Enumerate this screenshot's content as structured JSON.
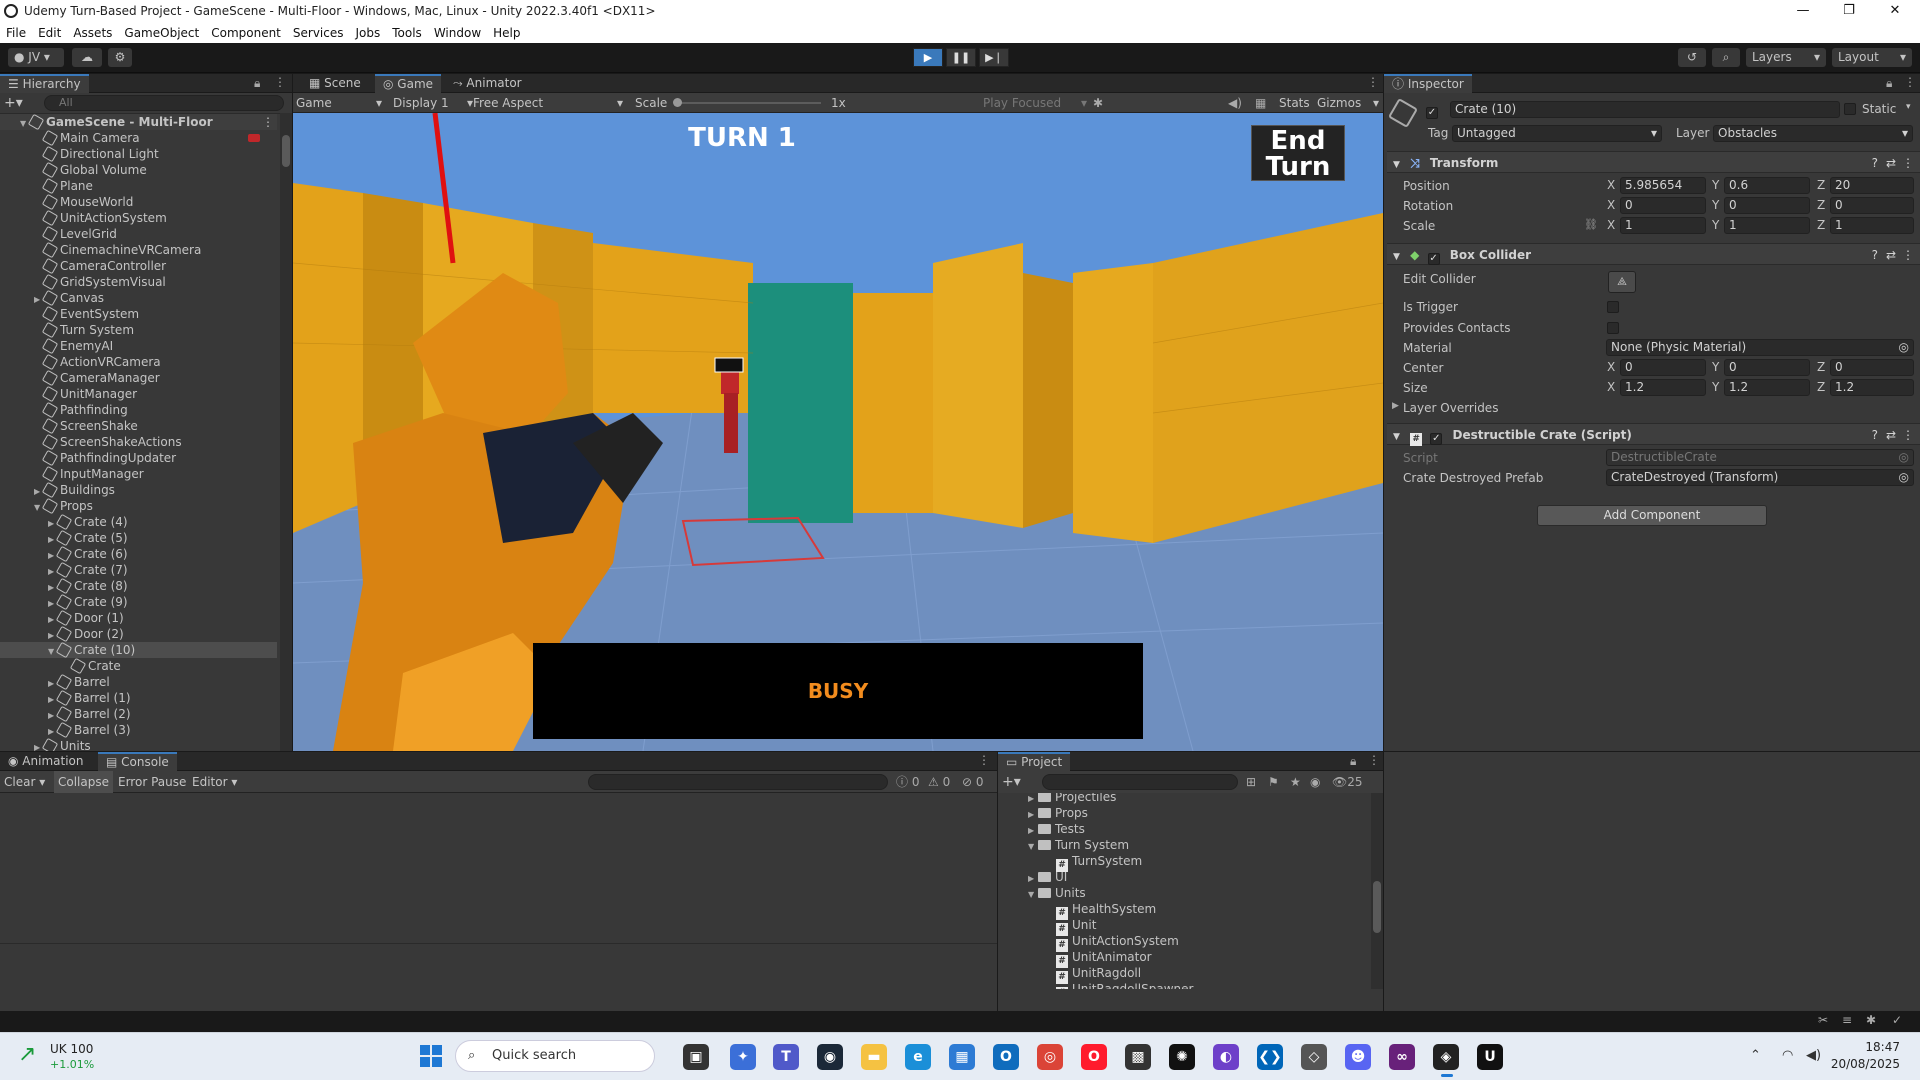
{
  "window": {
    "title": "Udemy Turn-Based Project - GameScene - Multi-Floor - Windows, Mac, Linux - Unity 2022.3.40f1 <DX11>",
    "minimize": "—",
    "maximize": "❐",
    "close": "✕"
  },
  "menu": [
    "File",
    "Edit",
    "Assets",
    "GameObject",
    "Component",
    "Services",
    "Jobs",
    "Tools",
    "Window",
    "Help"
  ],
  "toolbar": {
    "account": "JV",
    "layers": "Layers",
    "layout": "Layout"
  },
  "hierarchy": {
    "tab": "Hierarchy",
    "search_placeholder": "All",
    "items": [
      {
        "label": "GameScene - Multi-Floor",
        "depth": 0,
        "expanded": true,
        "scene": true
      },
      {
        "label": "Main Camera",
        "depth": 1
      },
      {
        "label": "Directional Light",
        "depth": 1
      },
      {
        "label": "Global Volume",
        "depth": 1
      },
      {
        "label": "Plane",
        "depth": 1
      },
      {
        "label": "MouseWorld",
        "depth": 1
      },
      {
        "label": "UnitActionSystem",
        "depth": 1
      },
      {
        "label": "LevelGrid",
        "depth": 1
      },
      {
        "label": "CinemachineVRCamera",
        "depth": 1
      },
      {
        "label": "CameraController",
        "depth": 1
      },
      {
        "label": "GridSystemVisual",
        "depth": 1
      },
      {
        "label": "Canvas",
        "depth": 1,
        "collapsed": true
      },
      {
        "label": "EventSystem",
        "depth": 1
      },
      {
        "label": "Turn System",
        "depth": 1
      },
      {
        "label": "EnemyAI",
        "depth": 1
      },
      {
        "label": "ActionVRCamera",
        "depth": 1
      },
      {
        "label": "CameraManager",
        "depth": 1
      },
      {
        "label": "UnitManager",
        "depth": 1
      },
      {
        "label": "Pathfinding",
        "depth": 1
      },
      {
        "label": "ScreenShake",
        "depth": 1
      },
      {
        "label": "ScreenShakeActions",
        "depth": 1
      },
      {
        "label": "PathfindingUpdater",
        "depth": 1
      },
      {
        "label": "InputManager",
        "depth": 1
      },
      {
        "label": "Buildings",
        "depth": 1,
        "collapsed": true
      },
      {
        "label": "Props",
        "depth": 1,
        "expanded": true
      },
      {
        "label": "Crate (4)",
        "depth": 2,
        "collapsed": true
      },
      {
        "label": "Crate (5)",
        "depth": 2,
        "collapsed": true
      },
      {
        "label": "Crate (6)",
        "depth": 2,
        "collapsed": true
      },
      {
        "label": "Crate (7)",
        "depth": 2,
        "collapsed": true
      },
      {
        "label": "Crate (8)",
        "depth": 2,
        "collapsed": true
      },
      {
        "label": "Crate (9)",
        "depth": 2,
        "collapsed": true
      },
      {
        "label": "Door (1)",
        "depth": 2,
        "collapsed": true
      },
      {
        "label": "Door (2)",
        "depth": 2,
        "collapsed": true
      },
      {
        "label": "Crate (10)",
        "depth": 2,
        "expanded": true,
        "selected": true
      },
      {
        "label": "Crate",
        "depth": 3
      },
      {
        "label": "Barrel",
        "depth": 2,
        "collapsed": true
      },
      {
        "label": "Barrel (1)",
        "depth": 2,
        "collapsed": true
      },
      {
        "label": "Barrel (2)",
        "depth": 2,
        "collapsed": true
      },
      {
        "label": "Barrel (3)",
        "depth": 2,
        "collapsed": true
      },
      {
        "label": "Units",
        "depth": 1,
        "collapsed": true
      }
    ]
  },
  "view_tabs": [
    "Scene",
    "Game",
    "Animator"
  ],
  "game_bar": {
    "game": "Game",
    "display": "Display 1",
    "aspect": "Free Aspect",
    "scale_label": "Scale",
    "scale_value": "1x",
    "play_focused": "Play Focused",
    "stats": "Stats",
    "gizmos": "Gizmos"
  },
  "game": {
    "turn": "TURN 1",
    "end_turn_line1": "End",
    "end_turn_line2": "Turn",
    "busy": "BUSY"
  },
  "inspector": {
    "tab": "Inspector",
    "object_name": "Crate (10)",
    "static": "Static",
    "tag_label": "Tag",
    "tag": "Untagged",
    "layer_label": "Layer",
    "layer": "Obstacles",
    "transform": {
      "title": "Transform",
      "position": {
        "label": "Position",
        "x": "5.985654",
        "y": "0.6",
        "z": "20"
      },
      "rotation": {
        "label": "Rotation",
        "x": "0",
        "y": "0",
        "z": "0"
      },
      "scale": {
        "label": "Scale",
        "x": "1",
        "y": "1",
        "z": "1"
      }
    },
    "box_collider": {
      "title": "Box Collider",
      "edit_collider": "Edit Collider",
      "is_trigger": "Is Trigger",
      "provides_contacts": "Provides Contacts",
      "material_label": "Material",
      "material": "None (Physic Material)",
      "center": {
        "label": "Center",
        "x": "0",
        "y": "0",
        "z": "0"
      },
      "size": {
        "label": "Size",
        "x": "1.2",
        "y": "1.2",
        "z": "1.2"
      },
      "layer_overrides": "Layer Overrides"
    },
    "script": {
      "title": "Destructible Crate (Script)",
      "script_label": "Script",
      "script_value": "DestructibleCrate",
      "prefab_label": "Crate Destroyed Prefab",
      "prefab_value": "CrateDestroyed (Transform)"
    },
    "add_component": "Add Component"
  },
  "console": {
    "tabs": [
      "Animation",
      "Console"
    ],
    "clear": "Clear",
    "collapse": "Collapse",
    "error_pause": "Error Pause",
    "editor": "Editor",
    "count_log": "0",
    "count_warn": "0",
    "count_err": "0"
  },
  "project": {
    "tab": "Project",
    "count": "25",
    "items": [
      {
        "label": "Projectiles",
        "type": "folder",
        "depth": 1
      },
      {
        "label": "Props",
        "type": "folder",
        "depth": 1
      },
      {
        "label": "Tests",
        "type": "folder",
        "depth": 1
      },
      {
        "label": "Turn System",
        "type": "folder",
        "depth": 1,
        "expanded": true
      },
      {
        "label": "TurnSystem",
        "type": "script",
        "depth": 2
      },
      {
        "label": "UI",
        "type": "folder",
        "depth": 1
      },
      {
        "label": "Units",
        "type": "folder",
        "depth": 1,
        "expanded": true
      },
      {
        "label": "HealthSystem",
        "type": "script",
        "depth": 2
      },
      {
        "label": "Unit",
        "type": "script",
        "depth": 2
      },
      {
        "label": "UnitActionSystem",
        "type": "script",
        "depth": 2
      },
      {
        "label": "UnitAnimator",
        "type": "script",
        "depth": 2
      },
      {
        "label": "UnitRagdoll",
        "type": "script",
        "depth": 2
      },
      {
        "label": "UnitRagdollSpawner",
        "type": "script",
        "depth": 2
      }
    ]
  },
  "taskbar": {
    "stock_name": "UK 100",
    "stock_change": "+1.01%",
    "search": "Quick search",
    "time": "18:47",
    "date": "20/08/2025"
  },
  "colors": {
    "accent": "#3a79bb",
    "busy_text": "#f28c1e",
    "selection": "#2c5d87"
  }
}
